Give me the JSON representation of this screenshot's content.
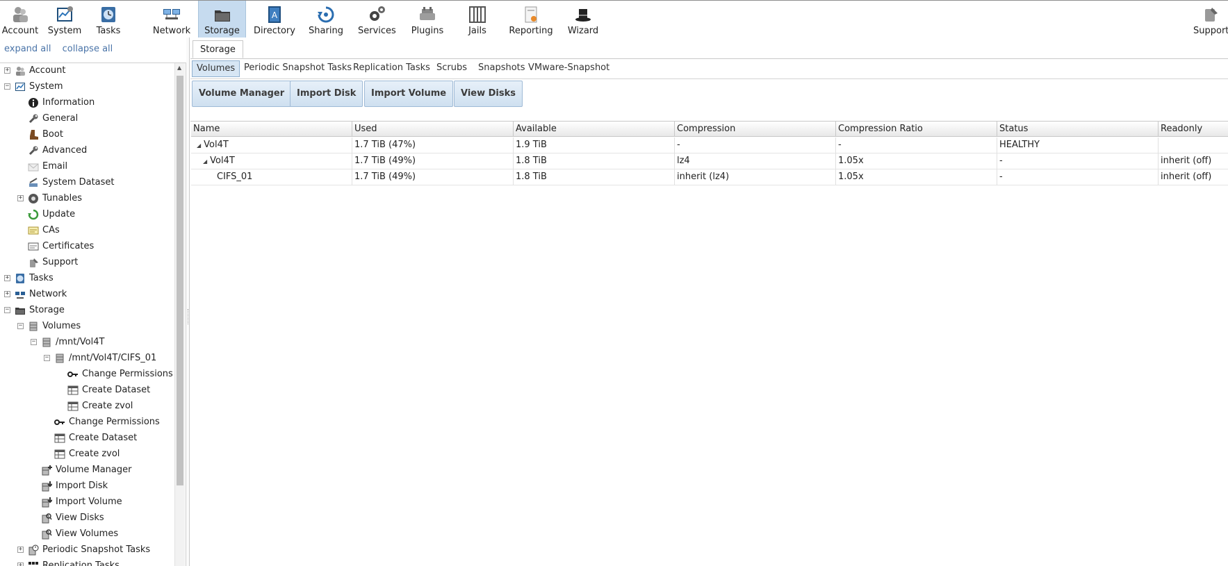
{
  "topnav": {
    "items": [
      {
        "label": "Account",
        "icon": "account-icon"
      },
      {
        "label": "System",
        "icon": "system-icon"
      },
      {
        "label": "Tasks",
        "icon": "tasks-icon"
      },
      {
        "label": "Network",
        "icon": "network-icon"
      },
      {
        "label": "Storage",
        "icon": "storage-icon",
        "active": true
      },
      {
        "label": "Directory",
        "icon": "directory-icon"
      },
      {
        "label": "Sharing",
        "icon": "sharing-icon"
      },
      {
        "label": "Services",
        "icon": "services-icon"
      },
      {
        "label": "Plugins",
        "icon": "plugins-icon"
      },
      {
        "label": "Jails",
        "icon": "jails-icon"
      },
      {
        "label": "Reporting",
        "icon": "reporting-icon"
      },
      {
        "label": "Wizard",
        "icon": "wizard-icon"
      }
    ],
    "support": {
      "label": "Support",
      "icon": "support-icon"
    }
  },
  "sidebar": {
    "expand_all": "expand all",
    "collapse_all": "collapse all",
    "tree": [
      {
        "label": "Account",
        "expander": "+",
        "icon": "account-icon"
      },
      {
        "label": "System",
        "expander": "−",
        "icon": "system-icon"
      },
      {
        "label": "Information",
        "icon": "info-icon"
      },
      {
        "label": "General",
        "icon": "wrench-icon"
      },
      {
        "label": "Boot",
        "icon": "boot-icon"
      },
      {
        "label": "Advanced",
        "icon": "wrench-icon"
      },
      {
        "label": "Email",
        "icon": "email-icon"
      },
      {
        "label": "System Dataset",
        "icon": "dataset-icon"
      },
      {
        "label": "Tunables",
        "expander": "+",
        "icon": "tunables-icon"
      },
      {
        "label": "Update",
        "icon": "update-icon"
      },
      {
        "label": "CAs",
        "icon": "ca-icon"
      },
      {
        "label": "Certificates",
        "icon": "certificate-icon"
      },
      {
        "label": "Support",
        "icon": "support-icon"
      },
      {
        "label": "Tasks",
        "expander": "+",
        "icon": "tasks-icon"
      },
      {
        "label": "Network",
        "expander": "+",
        "icon": "network-icon"
      },
      {
        "label": "Storage",
        "expander": "−",
        "icon": "storage-icon"
      },
      {
        "label": "Volumes",
        "expander": "−",
        "icon": "volume-icon"
      },
      {
        "label": "/mnt/Vol4T",
        "expander": "−",
        "icon": "volume-icon"
      },
      {
        "label": "/mnt/Vol4T/CIFS_01",
        "expander": "−",
        "icon": "volume-icon"
      },
      {
        "label": "Change Permissions",
        "icon": "key-icon"
      },
      {
        "label": "Create Dataset",
        "icon": "table-icon"
      },
      {
        "label": "Create zvol",
        "icon": "table-icon"
      },
      {
        "label": "Change Permissions",
        "icon": "key-icon"
      },
      {
        "label": "Create Dataset",
        "icon": "table-icon"
      },
      {
        "label": "Create zvol",
        "icon": "table-icon"
      },
      {
        "label": "Volume Manager",
        "icon": "volume-manager-icon"
      },
      {
        "label": "Import Disk",
        "icon": "import-icon"
      },
      {
        "label": "Import Volume",
        "icon": "import-icon"
      },
      {
        "label": "View Disks",
        "icon": "view-icon"
      },
      {
        "label": "View Volumes",
        "icon": "view-icon"
      },
      {
        "label": "Periodic Snapshot Tasks",
        "expander": "+",
        "icon": "snapshot-icon"
      },
      {
        "label": "Replication Tasks",
        "expander": "+",
        "icon": "replication-icon"
      }
    ]
  },
  "main": {
    "outer_tab": "Storage",
    "subtabs": [
      "Volumes",
      "Periodic Snapshot Tasks",
      "Replication Tasks",
      "Scrubs",
      "Snapshots",
      "VMware-Snapshot"
    ],
    "buttons": [
      "Volume Manager",
      "Import Disk",
      "Import Volume",
      "View Disks"
    ],
    "grid": {
      "columns": [
        "Name",
        "Used",
        "Available",
        "Compression",
        "Compression Ratio",
        "Status",
        "Readonly"
      ],
      "rows": [
        {
          "name": "Vol4T",
          "expander": "◢",
          "used": "1.7 TiB (47%)",
          "available": "1.9 TiB",
          "compression": "-",
          "ratio": "-",
          "status": "HEALTHY",
          "readonly": ""
        },
        {
          "name": "Vol4T",
          "expander": "◢",
          "used": "1.7 TiB (49%)",
          "available": "1.8 TiB",
          "compression": "lz4",
          "ratio": "1.05x",
          "status": "-",
          "readonly": "inherit (off)"
        },
        {
          "name": "CIFS_01",
          "used": "1.7 TiB (49%)",
          "available": "1.8 TiB",
          "compression": "inherit (lz4)",
          "ratio": "1.05x",
          "status": "-",
          "readonly": "inherit (off)"
        }
      ]
    }
  },
  "colors": {
    "active_nav": "#c6dbef",
    "button_border": "#9fbad6",
    "link": "#4a74a8"
  }
}
